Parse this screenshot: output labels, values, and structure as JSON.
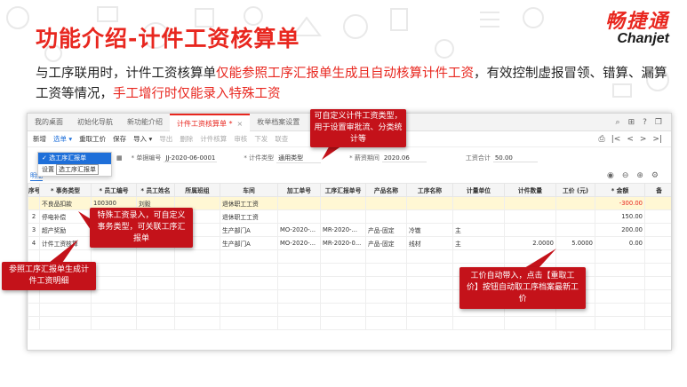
{
  "slide": {
    "title": "功能介绍-计件工资核算单",
    "desc_part1": "与工序联用时，计件工资核算单",
    "desc_part2": "仅能参照工序汇报单生成且自动核算计件工资",
    "desc_part3": "，有效控制虚报冒领、错算、漏算工资等情况，",
    "desc_part4": "手工增行时仅能录入特殊工资"
  },
  "logo": {
    "cn": "畅捷通",
    "en": "Chanjet"
  },
  "tabs": [
    {
      "label": "我的桌面",
      "active": false
    },
    {
      "label": "初始化导航",
      "active": false
    },
    {
      "label": "新功能介绍",
      "active": false
    },
    {
      "label": "计件工资核算单 *",
      "active": true
    },
    {
      "label": "枚举档案设置",
      "active": false
    }
  ],
  "toolbar": {
    "new": "新增",
    "select": "选单 ▾",
    "fetch_wage": "重取工价",
    "save": "保存",
    "import": "导入 ▾",
    "export": "导出",
    "delete": "删除",
    "calc": "计件核算",
    "audit": "审核",
    "dispatch": "下发",
    "query": "联查"
  },
  "dropdown": {
    "item1": "✓ 选工序汇报单",
    "item2": "设置",
    "tip": "选工序汇报单"
  },
  "form": {
    "doc_no_label": "* 单据编号",
    "doc_no": "JJ-2020-06-0001",
    "type_label": "* 计件类型",
    "type": "通用类型",
    "period_label": "* 薪资期间",
    "period": "2020.06",
    "total_label": "工资合计",
    "total": "50.00"
  },
  "subtab": "明细",
  "table": {
    "headers": [
      "序号",
      "* 事务类型",
      "* 员工编号",
      "* 员工姓名",
      "所属班组",
      "车间",
      "加工单号",
      "工序汇报单号",
      "产品名称",
      "工序名称",
      "计量单位",
      "计件数量",
      "工价 (元)",
      "* 金额",
      "备"
    ],
    "rows": [
      [
        "",
        "不良品扣款",
        "100300",
        "刘毅",
        "",
        "退休职工工资",
        "",
        "",
        "",
        "",
        "",
        "",
        "",
        "-300.00",
        ""
      ],
      [
        "2",
        "停电补偿",
        "",
        "",
        "",
        "退休职工工资",
        "",
        "",
        "",
        "",
        "",
        "",
        "",
        "150.00",
        ""
      ],
      [
        "3",
        "超产奖励",
        "",
        "",
        "",
        "生产部门A",
        "MO-2020-...",
        "MR-2020-...",
        "产品-固定",
        "冷镦",
        "主",
        "",
        "",
        "200.00",
        ""
      ],
      [
        "4",
        "计件工资核算",
        "",
        "",
        "",
        "生产部门A",
        "MO-2020-...",
        "MR-2020-0...",
        "产品-固定",
        "线材",
        "主",
        "2.0000",
        "5.0000",
        "0.00",
        ""
      ],
      [
        "",
        "",
        "",
        "",
        "",
        "",
        "",
        "",
        "",
        "",
        "",
        "",
        "",
        "",
        ""
      ],
      [
        "",
        "",
        "",
        "",
        "",
        "",
        "",
        "",
        "",
        "",
        "",
        "",
        "",
        "",
        ""
      ],
      [
        "",
        "",
        "",
        "",
        "",
        "",
        "",
        "",
        "",
        "",
        "",
        "",
        "",
        "",
        ""
      ],
      [
        "",
        "",
        "",
        "",
        "",
        "",
        "",
        "",
        "",
        "",
        "",
        "",
        "",
        "",
        ""
      ],
      [
        "",
        "",
        "",
        "",
        "",
        "",
        "",
        "",
        "",
        "",
        "",
        "",
        "",
        "",
        ""
      ],
      [
        "",
        "",
        "",
        "",
        "",
        "",
        "",
        "",
        "",
        "",
        "",
        "",
        "",
        "",
        ""
      ]
    ]
  },
  "callouts": {
    "type_define": "可自定义计件工资类型，用于设置审批流、分类统计等",
    "special_wage": "特殊工资录入，可自定义事务类型，可关联工序汇报单",
    "reference": "参照工序汇报单生成计件工资明细",
    "auto_fetch": "工价自动带入，点击【重取工价】按钮自动取工序档案最新工价"
  },
  "colors": {
    "brand_red": "#e8271f",
    "callout_red": "#c4121a",
    "link_blue": "#1e6fd9"
  }
}
